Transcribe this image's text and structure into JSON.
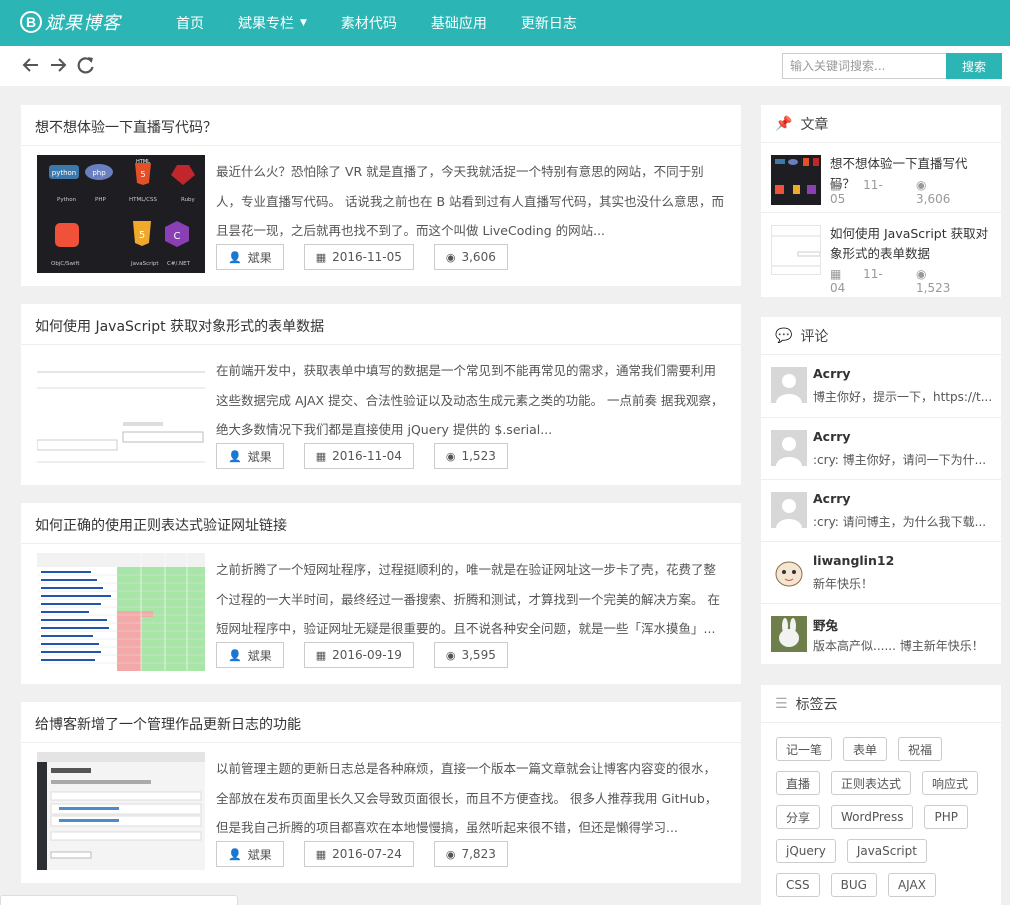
{
  "site": {
    "logo_letter": "B",
    "logo_text": "斌果博客"
  },
  "nav": [
    "首页",
    "斌果专栏",
    "素材代码",
    "基础应用",
    "更新日志"
  ],
  "search": {
    "placeholder": "输入关键词搜索...",
    "button": "搜索"
  },
  "articles": [
    {
      "title": "想不想体验一下直播写代码？",
      "excerpt": "最近什么火？恐怕除了 VR 就是直播了，今天我就活捉一个特别有意思的网站，不同于别人，专业直播写代码。 话说我之前也在 B 站看到过有人直播写代码，其实也没什么意思，而且昙花一现，之后就再也找不到了。而这个叫做 LiveCoding 的网站...",
      "author": "斌果",
      "date": "2016-11-05",
      "views": "3,606"
    },
    {
      "title": "如何使用 JavaScript 获取对象形式的表单数据",
      "excerpt": "在前端开发中，获取表单中填写的数据是一个常见到不能再常见的需求，通常我们需要利用这些数据完成 AJAX 提交、合法性验证以及动态生成元素之类的功能。 一点前奏 据我观察，绝大多数情况下我们都是直接使用 jQuery 提供的 $.serial...",
      "author": "斌果",
      "date": "2016-11-04",
      "views": "1,523"
    },
    {
      "title": "如何正确的使用正则表达式验证网址链接",
      "excerpt": "之前折腾了一个短网址程序，过程挺顺利的，唯一就是在验证网址这一步卡了壳，花费了整个过程的一大半时间，最终经过一番搜索、折腾和测试，才算找到一个完美的解决方案。 在短网址程序中，验证网址无疑是很重要的。且不说各种安全问题，就是一些「浑水摸鱼」...",
      "author": "斌果",
      "date": "2016-09-19",
      "views": "3,595"
    },
    {
      "title": "给博客新增了一个管理作品更新日志的功能",
      "excerpt": "以前管理主题的更新日志总是各种麻烦，直接一个版本一篇文章就会让博客内容变的很水，全部放在发布页面里长久又会导致页面很长，而且不方便查找。 很多人推荐我用 GitHub，但是我自己折腾的项目都喜欢在本地慢慢搞，虽然听起来很不错，但还是懒得学习...",
      "author": "斌果",
      "date": "2016-07-24",
      "views": "7,823"
    }
  ],
  "thumb1_labels": [
    "python",
    "php",
    "HTML",
    "Python",
    "PHP",
    "HTML/CSS",
    "Ruby",
    "ObjC/Swift",
    "JavaScript",
    "C#/.NET"
  ],
  "sidebar": {
    "articles_title": "文章",
    "articles": [
      {
        "title": "想不想体验一下直播写代码？",
        "date": "11-05",
        "views": "3,606"
      },
      {
        "title": "如何使用 JavaScript 获取对象形式的表单数据",
        "date": "11-04",
        "views": "1,523"
      }
    ],
    "comments_title": "评论",
    "comments": [
      {
        "name": "Acrry",
        "text": "博主你好，提示一下，https://t..."
      },
      {
        "name": "Acrry",
        "text": ":cry: 博主你好，请问一下为什..."
      },
      {
        "name": "Acrry",
        "text": ":cry: 请问博主，为什么我下载..."
      },
      {
        "name": "liwanglin12",
        "text": "新年快乐！"
      },
      {
        "name": "野兔",
        "text": "版本高产似...... 博主新年快乐！"
      }
    ],
    "tags_title": "标签云",
    "tags": [
      "记一笔",
      "表单",
      "祝福",
      "直播",
      "正则表达式",
      "响应式",
      "分享",
      "WordPress",
      "PHP",
      "jQuery",
      "JavaScript",
      "CSS",
      "BUG",
      "AJAX"
    ]
  },
  "colors": {
    "accent": "#2cb5b5",
    "background": "#f0f0f0"
  },
  "icons": {
    "back": "arrow-left-icon",
    "forward": "arrow-right-icon",
    "refresh": "refresh-icon",
    "pin": "pin-icon",
    "comment": "comment-icon",
    "tags": "list-icon",
    "user": "user-icon",
    "calendar": "calendar-icon",
    "eye": "eye-icon"
  }
}
